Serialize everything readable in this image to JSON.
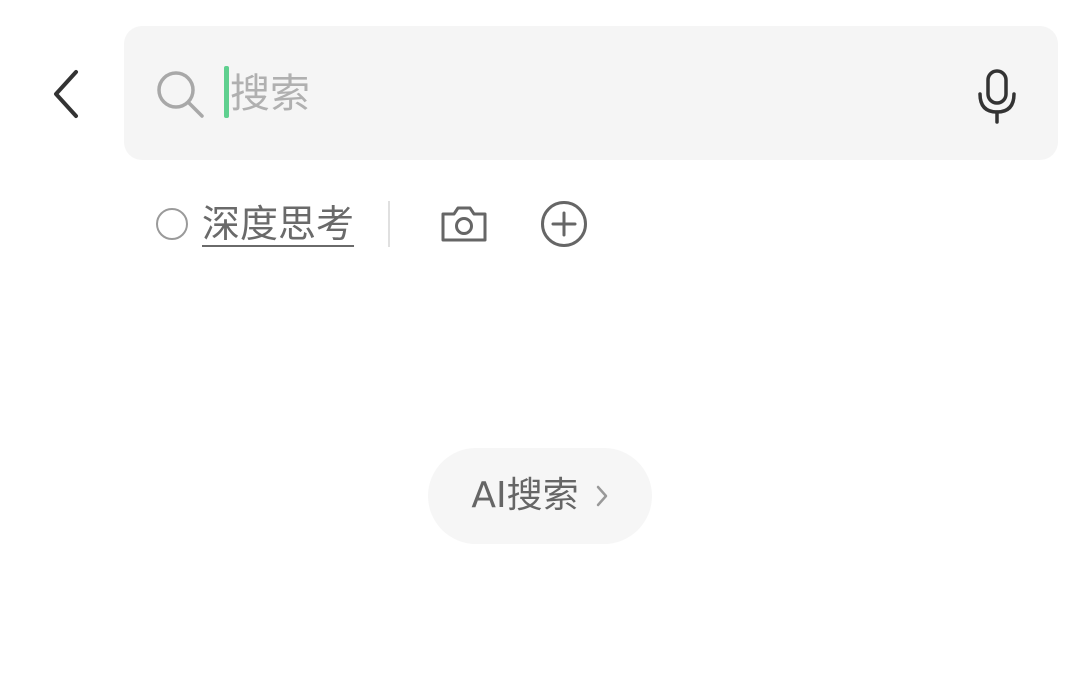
{
  "search": {
    "placeholder": "搜索",
    "value": ""
  },
  "options": {
    "deep_think_label": "深度思考",
    "deep_think_selected": false
  },
  "ai_search": {
    "label": "AI搜索"
  },
  "icons": {
    "back": "chevron-left-icon",
    "search": "search-icon",
    "mic": "microphone-icon",
    "camera": "camera-icon",
    "plus": "plus-circle-icon",
    "ai_arrow": "chevron-right-icon"
  },
  "colors": {
    "caret": "#5fd08f",
    "search_bg": "#f5f5f5",
    "pill_bg": "#f6f6f6"
  }
}
